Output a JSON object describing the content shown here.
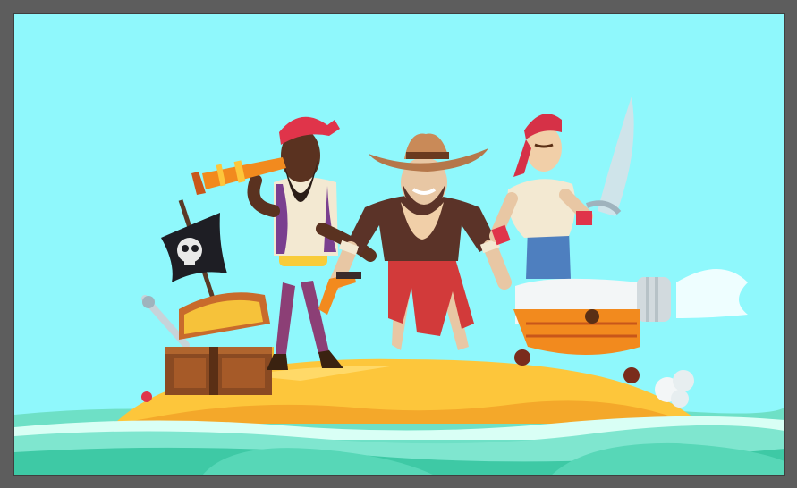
{
  "app": {
    "window_background": "#5d5d5d"
  },
  "artwork": {
    "subject": "pirate-crew-on-island-illustration",
    "colors": {
      "sky": "#8ff8fc",
      "sand": "#fdc63b",
      "sand_shadow": "#f4a82a",
      "sea_light": "#7fe6cf",
      "sea_dark": "#3ec9a5",
      "foam": "#d9fff5",
      "bandana_red": "#e0344a",
      "hat_brown": "#b5774a",
      "cannon_body": "#f3f6f7",
      "cannon_cart": "#f28a1e"
    },
    "icons": [
      "skull-flag-icon",
      "treasure-chest-icon",
      "spyglass-icon",
      "cannon-icon",
      "cutlass-icon",
      "cowboy-hat-icon",
      "bandana-icon"
    ]
  }
}
